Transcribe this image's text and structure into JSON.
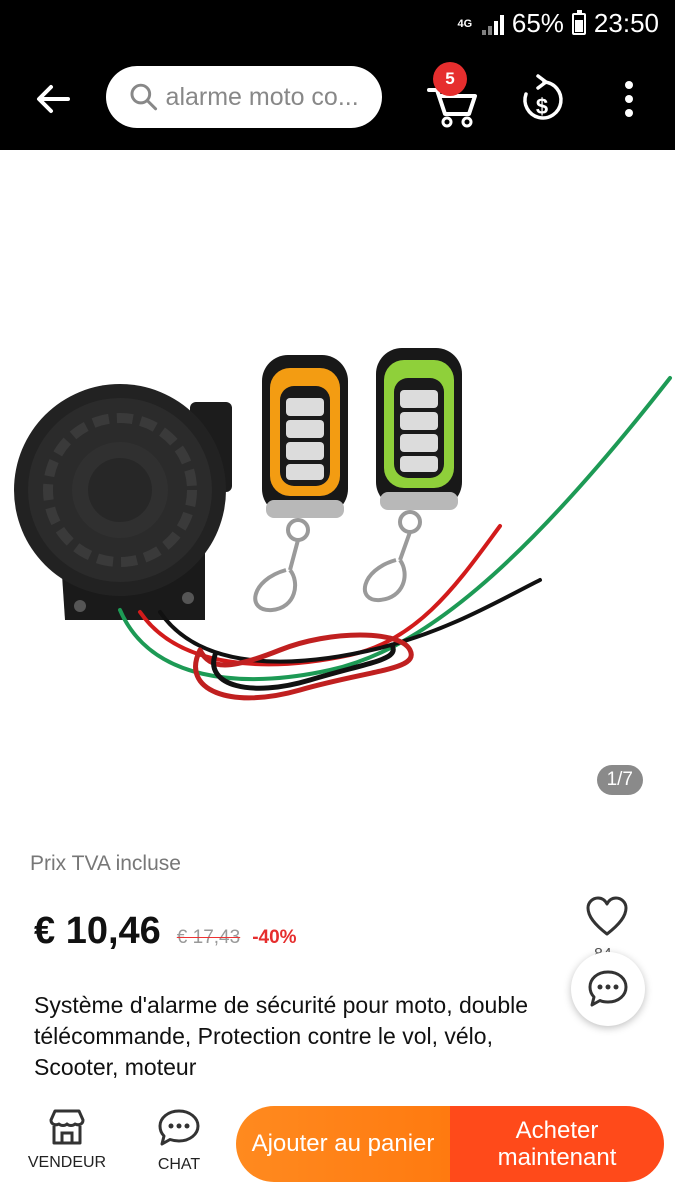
{
  "status_bar": {
    "network": "4G",
    "battery": "65%",
    "time": "23:50"
  },
  "header": {
    "search_text": "alarme moto co...",
    "cart_count": "5"
  },
  "gallery": {
    "counter": "1/7"
  },
  "product": {
    "vat_label": "Prix TVA incluse",
    "price": "€ 10,46",
    "old_price": "€ 17,43",
    "discount": "-40%",
    "wish_count": "84",
    "title": "Système d'alarme de sécurité pour moto, double télécommande, Protection contre le vol, vélo, Scooter, moteur"
  },
  "bottom_bar": {
    "vendor_label": "VENDEUR",
    "chat_label": "CHAT",
    "add_to_cart": "Ajouter au panier",
    "buy_now": "Acheter maintenant"
  },
  "colors": {
    "accent_red": "#e62e2e",
    "cart_orange": "#ff8a1f",
    "buy_orange": "#ff4a1a"
  }
}
